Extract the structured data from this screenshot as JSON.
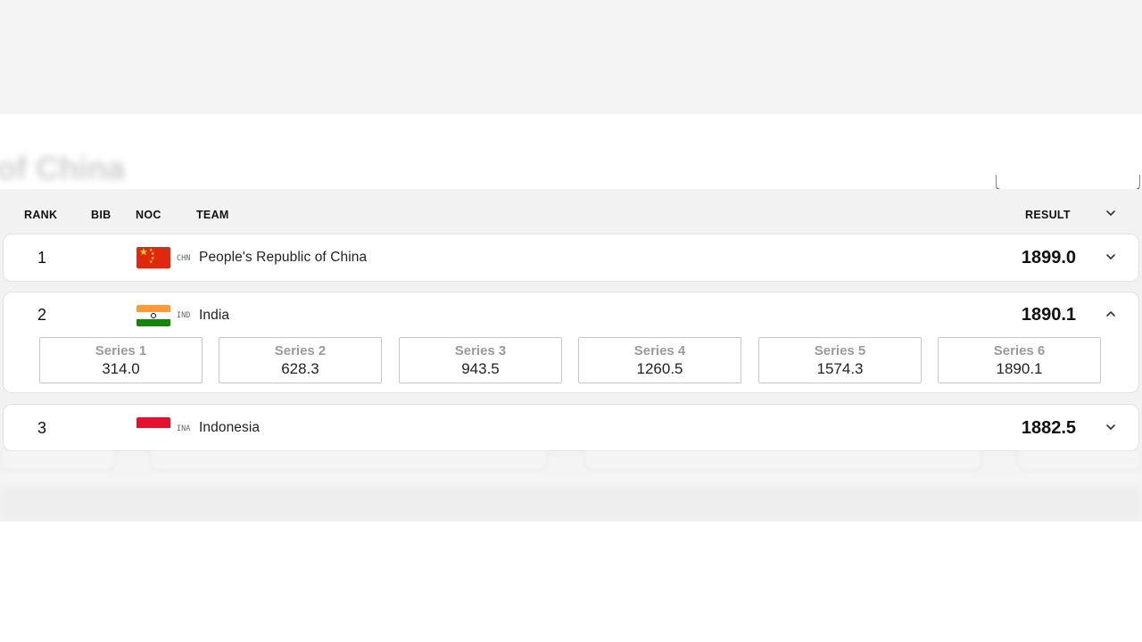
{
  "page": {
    "background_title": "of China"
  },
  "table": {
    "headers": {
      "rank": "RANK",
      "bib": "BIB",
      "noc": "NOC",
      "team": "TEAM",
      "result": "RESULT"
    },
    "rows": [
      {
        "rank": "1",
        "noc": "CHN",
        "team": "People's Republic of China",
        "result": "1899.0",
        "expanded": false
      },
      {
        "rank": "2",
        "noc": "IND",
        "team": "India",
        "result": "1890.1",
        "expanded": true,
        "series": [
          {
            "label": "Series 1",
            "value": "314.0"
          },
          {
            "label": "Series 2",
            "value": "628.3"
          },
          {
            "label": "Series 3",
            "value": "943.5"
          },
          {
            "label": "Series 4",
            "value": "1260.5"
          },
          {
            "label": "Series 5",
            "value": "1574.3"
          },
          {
            "label": "Series 6",
            "value": "1890.1"
          }
        ]
      },
      {
        "rank": "3",
        "noc": "INA",
        "team": "Indonesia",
        "result": "1882.5",
        "expanded": false
      }
    ]
  },
  "icons": {
    "header_toggle": "chevron-down-icon",
    "row_collapsed": "chevron-down-icon",
    "row_expanded": "chevron-up-icon"
  },
  "colors": {
    "china_red": "#de2910",
    "china_star": "#ffde00",
    "india_saffron": "#ff9933",
    "india_green": "#138808",
    "indonesia_red": "#e8112d"
  }
}
